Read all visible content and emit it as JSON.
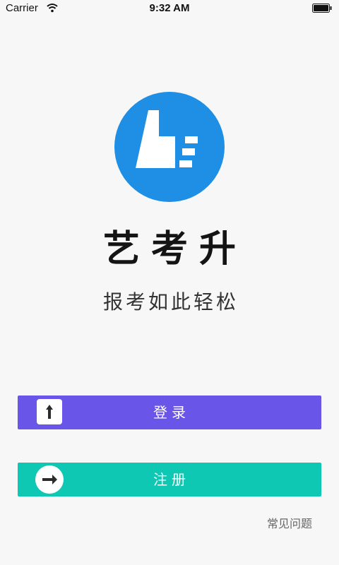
{
  "status_bar": {
    "carrier": "Carrier",
    "time": "9:32 AM",
    "wifi_icon": "wifi-icon",
    "battery_icon": "battery-icon"
  },
  "logo": {
    "icon": "thumbs-up-logo-icon",
    "color": "#1f8fe5"
  },
  "app": {
    "title": "艺考升",
    "slogan": "报考如此轻松"
  },
  "buttons": {
    "login": {
      "label": "登录",
      "icon": "arrow-up-icon",
      "color": "#6956e8"
    },
    "register": {
      "label": "注册",
      "icon": "arrow-right-icon",
      "color": "#0ec8b3"
    }
  },
  "links": {
    "faq": "常见问题"
  }
}
